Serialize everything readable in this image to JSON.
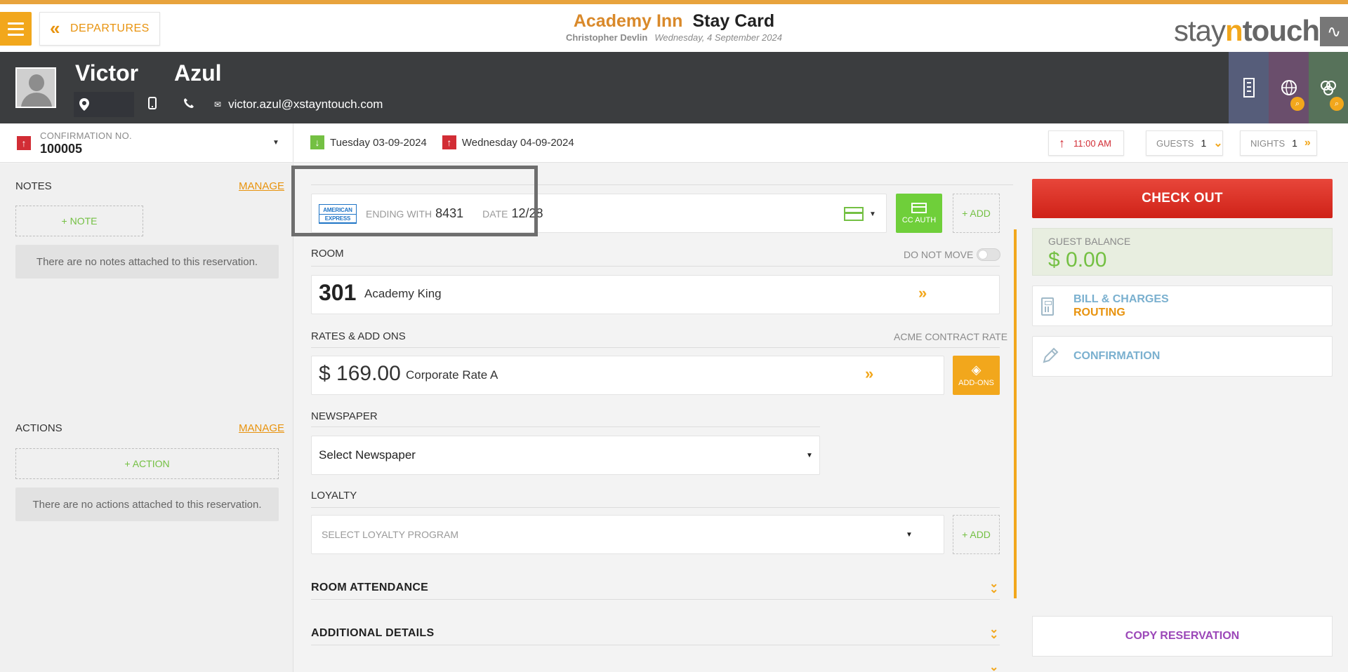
{
  "header": {
    "back_label": "DEPARTURES",
    "hotel_name": "Academy Inn",
    "page_title": "Stay Card",
    "user_name": "Christopher Devlin",
    "date_text": "Wednesday, 4 September 2024",
    "brand_prefix": "stay",
    "brand_n": "n",
    "brand_suffix": "touch"
  },
  "guest": {
    "first_name": "Victor",
    "last_name": "Azul",
    "email": "victor.azul@xstayntouch.com"
  },
  "reservation": {
    "confirmation_label": "CONFIRMATION NO.",
    "confirmation_number": "100005",
    "arrival": "Tuesday 03-09-2024",
    "departure": "Wednesday 04-09-2024",
    "checkout_time": "11:00 AM",
    "guests_label": "GUESTS",
    "guests_count": "1",
    "nights_label": "NIGHTS",
    "nights_count": "1"
  },
  "notes": {
    "title": "NOTES",
    "manage_label": "MANAGE",
    "add_label": "+ NOTE",
    "empty_text": "There are no notes attached to this reservation."
  },
  "actions": {
    "title": "ACTIONS",
    "manage_label": "MANAGE",
    "add_label": "+ ACTION",
    "empty_text": "There are no actions attached to this reservation."
  },
  "payment": {
    "card_brand_line1": "AMERICAN",
    "card_brand_line2": "EXPRESS",
    "ending_label": "ENDING WITH",
    "ending_value": "8431",
    "date_label": "DATE",
    "date_value": "12/28",
    "cc_auth_label": "CC AUTH",
    "add_label": "+ ADD"
  },
  "room": {
    "section_label": "ROOM",
    "do_not_move_label": "DO NOT MOVE",
    "number": "301",
    "type": "Academy King"
  },
  "rates": {
    "section_label": "RATES & ADD ONS",
    "contract_label": "ACME CONTRACT RATE",
    "amount": "$ 169.00",
    "name": "Corporate Rate A",
    "addons_label": "ADD-ONS"
  },
  "newspaper": {
    "section_label": "NEWSPAPER",
    "selected": "Select Newspaper"
  },
  "loyalty": {
    "section_label": "LOYALTY",
    "placeholder": "SELECT LOYALTY PROGRAM",
    "add_label": "+ ADD"
  },
  "sections": {
    "room_attendance": "ROOM ATTENDANCE",
    "additional_details": "ADDITIONAL DETAILS"
  },
  "sidebar_right": {
    "checkout_label": "CHECK OUT",
    "balance_label": "GUEST BALANCE",
    "balance_value": "$ 0.00",
    "bill_label": "BILL & CHARGES",
    "routing_label": "ROUTING",
    "confirmation_label": "CONFIRMATION",
    "copy_label": "COPY RESERVATION"
  },
  "colors": {
    "accent": "#f2a71c",
    "danger": "#d22d35",
    "success": "#74c043",
    "header_dark": "#3b3d3f"
  }
}
